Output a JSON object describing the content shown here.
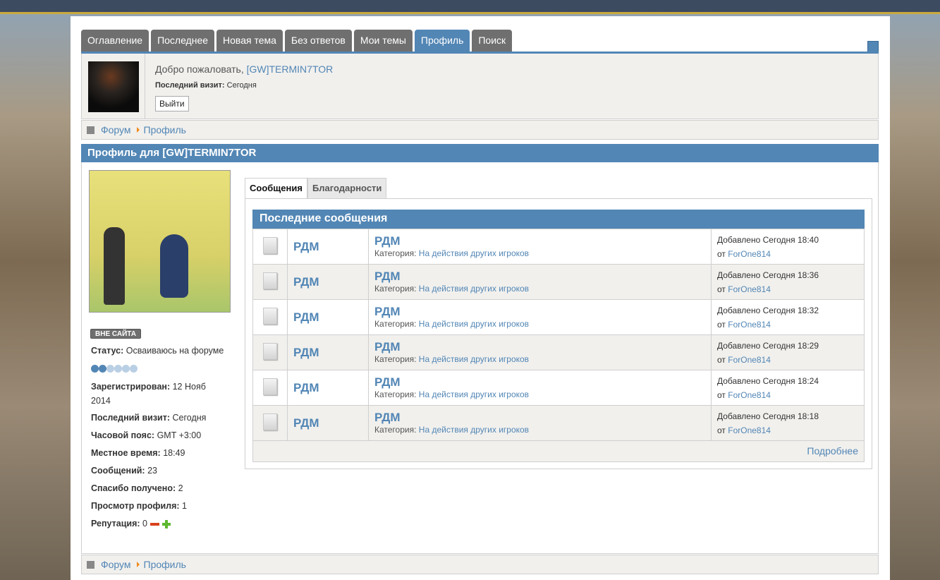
{
  "nav": {
    "tabs": [
      "Оглавление",
      "Последнее",
      "Новая тема",
      "Без ответов",
      "Мои темы",
      "Профиль",
      "Поиск"
    ],
    "active": "Профиль"
  },
  "user": {
    "welcome": "Добро пожаловать, ",
    "username": "[GW]TERMIN7TOR",
    "last_visit_label": "Последний визит:",
    "last_visit_value": "Сегодня",
    "logout": "Выйти"
  },
  "breadcrumb": {
    "forum": "Форум",
    "profile": "Профиль"
  },
  "profile": {
    "title": "Профиль для [GW]TERMIN7TOR",
    "status_badge": "ВНЕ САЙТА",
    "rank_dots": {
      "filled": 2,
      "total": 6
    },
    "fields": [
      {
        "label": "Статус:",
        "value": "Осваиваюсь на форуме"
      },
      {
        "label": "Зарегистрирован:",
        "value": "12 Нояб 2014"
      },
      {
        "label": "Последний визит:",
        "value": "Сегодня"
      },
      {
        "label": "Часовой пояс:",
        "value": "GMT +3:00"
      },
      {
        "label": "Местное время:",
        "value": "18:49"
      },
      {
        "label": "Сообщений:",
        "value": "23"
      },
      {
        "label": "Спасибо получено:",
        "value": "2"
      },
      {
        "label": "Просмотр профиля:",
        "value": "1"
      },
      {
        "label": "Репутация:",
        "value": "0"
      }
    ]
  },
  "content_tabs": [
    "Сообщения",
    "Благодарности"
  ],
  "posts": {
    "title": "Последние сообщения",
    "category_label": "Категория:",
    "added_label": "Добавлено",
    "by_label": "от",
    "more": "Подробнее",
    "rows": [
      {
        "topic": "РДМ",
        "title": "РДМ",
        "category": "На действия других игроков",
        "date": "Сегодня 18:40",
        "author": "ForOne814"
      },
      {
        "topic": "РДМ",
        "title": "РДМ",
        "category": "На действия других игроков",
        "date": "Сегодня 18:36",
        "author": "ForOne814"
      },
      {
        "topic": "РДМ",
        "title": "РДМ",
        "category": "На действия других игроков",
        "date": "Сегодня 18:32",
        "author": "ForOne814"
      },
      {
        "topic": "РДМ",
        "title": "РДМ",
        "category": "На действия других игроков",
        "date": "Сегодня 18:29",
        "author": "ForOne814"
      },
      {
        "topic": "РДМ",
        "title": "РДМ",
        "category": "На действия других игроков",
        "date": "Сегодня 18:24",
        "author": "ForOne814"
      },
      {
        "topic": "РДМ",
        "title": "РДМ",
        "category": "На действия других игроков",
        "date": "Сегодня 18:18",
        "author": "ForOne814"
      }
    ]
  },
  "colors": {
    "accent": "#5286b5",
    "tab_inactive": "#6f6f6f",
    "topbar": "#3d4b60",
    "gold": "#c9a93e"
  }
}
